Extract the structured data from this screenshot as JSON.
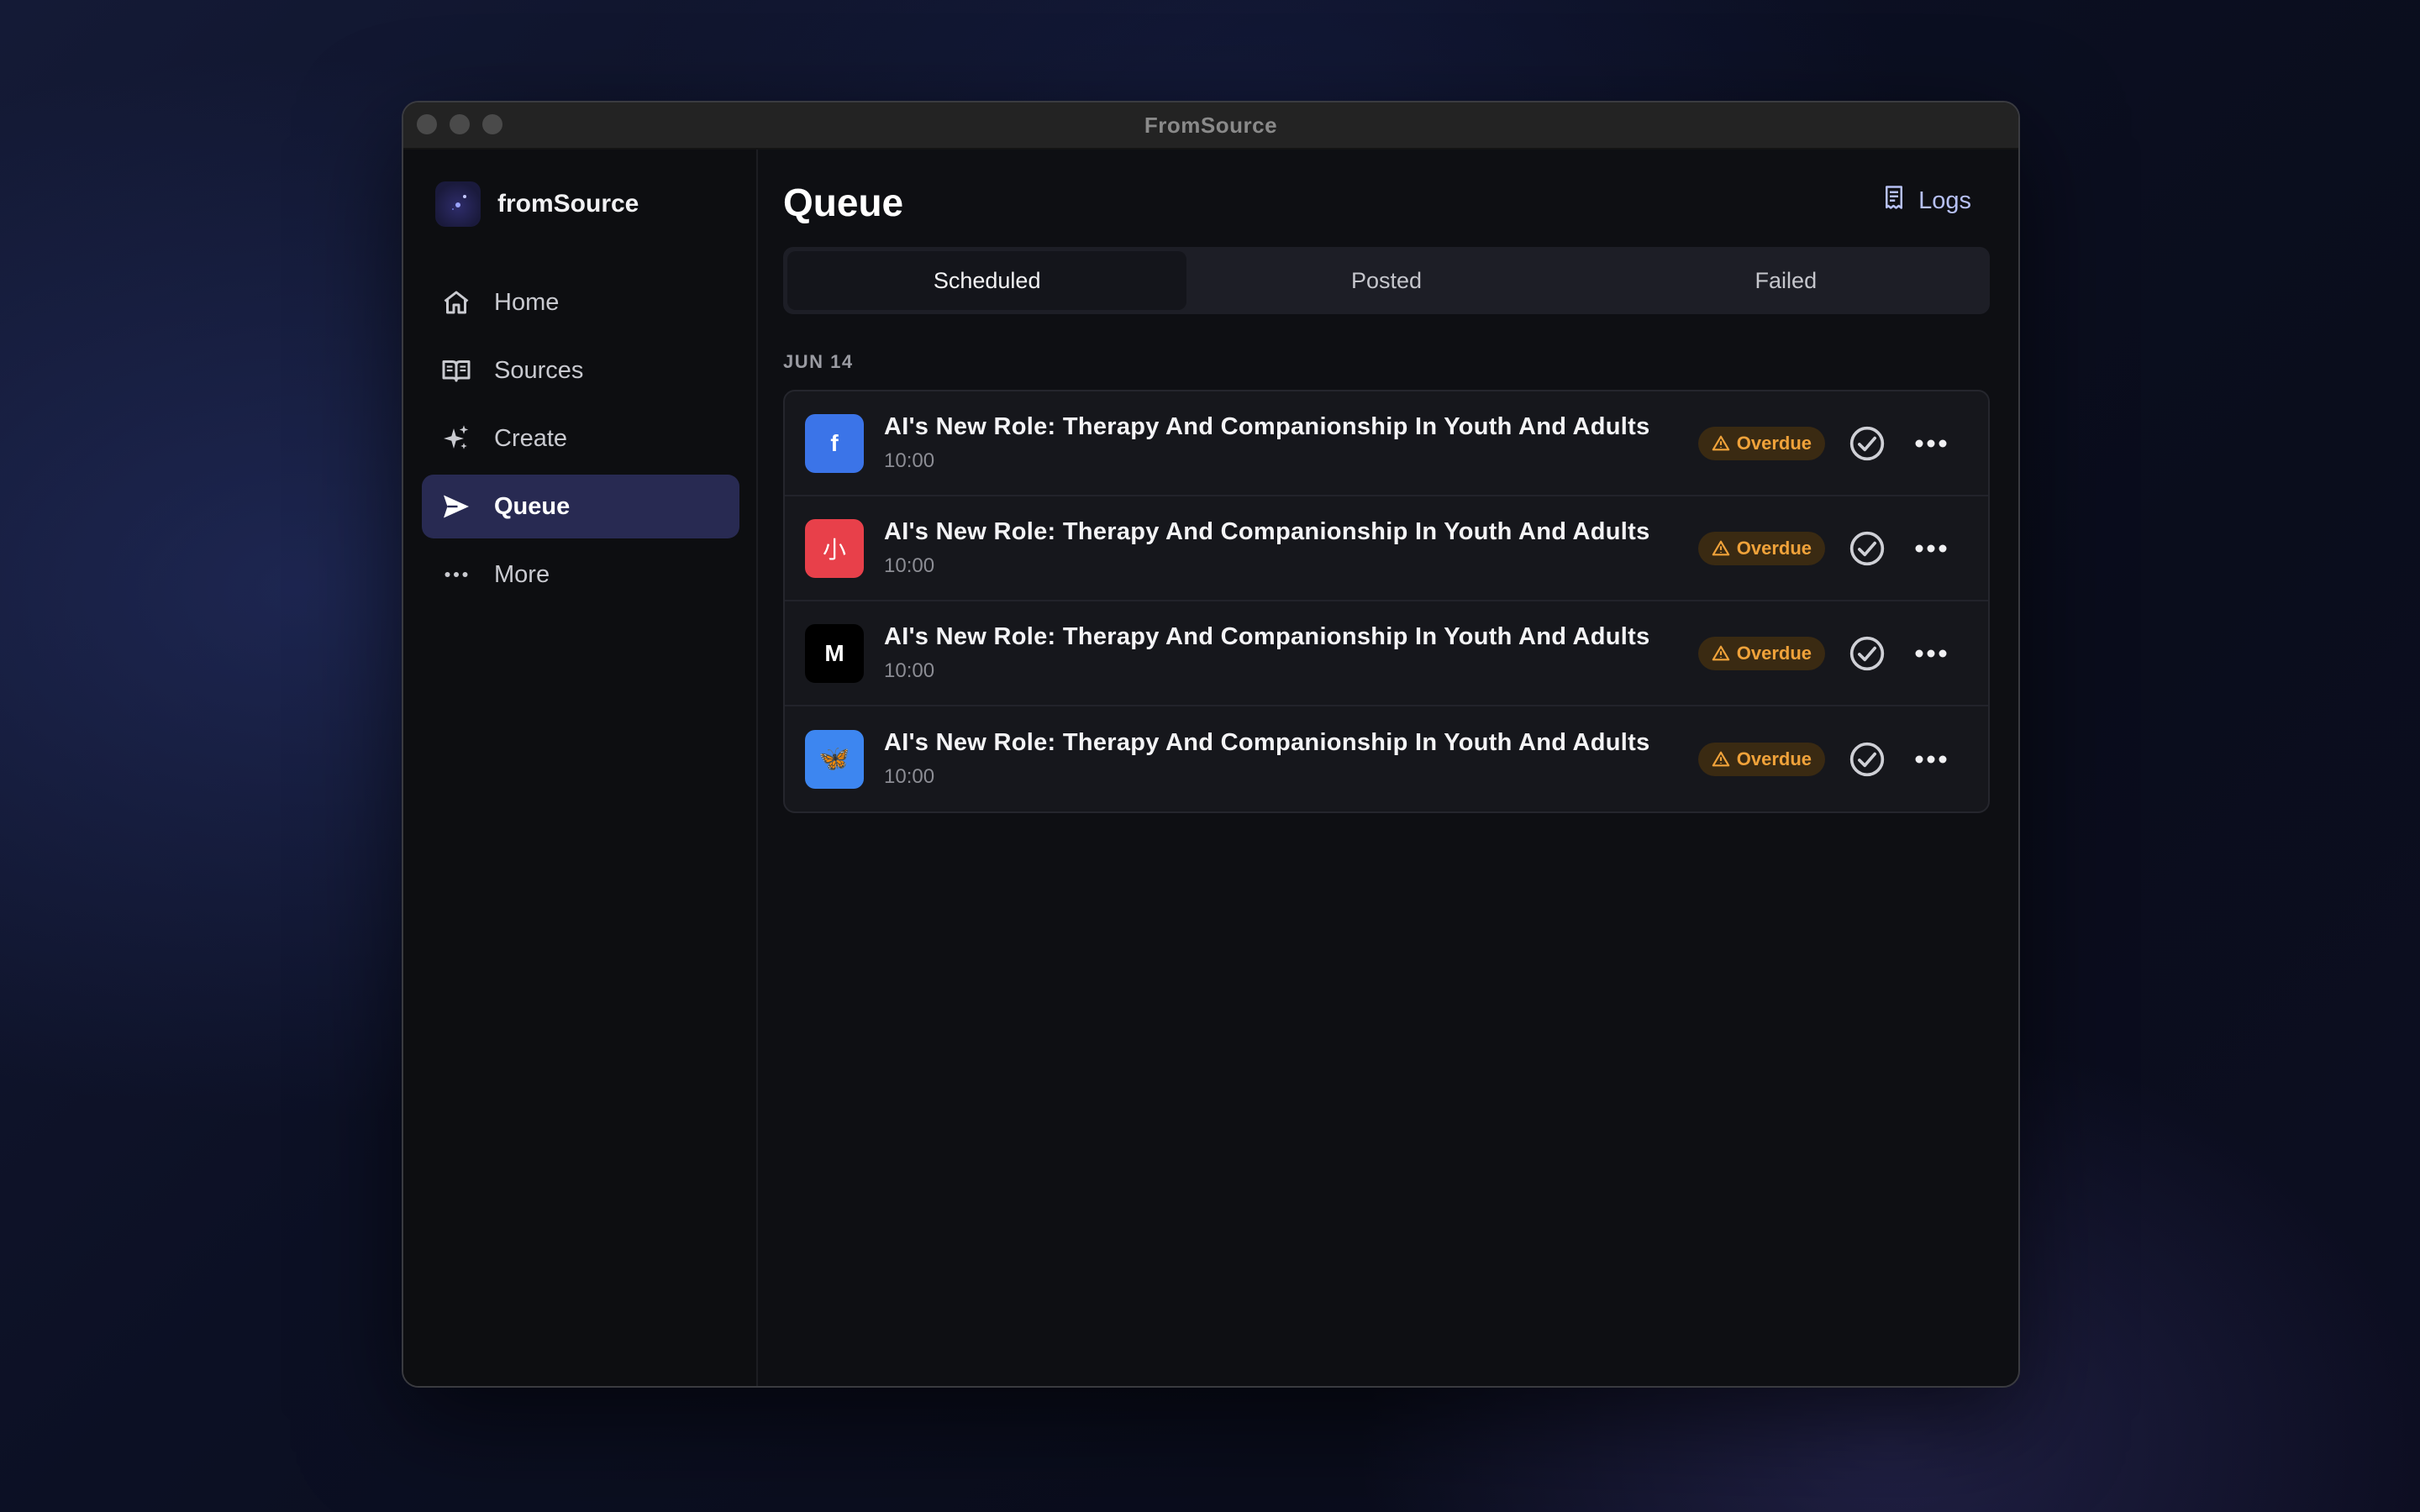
{
  "window": {
    "title": "FromSource"
  },
  "brand": {
    "name": "fromSource"
  },
  "nav": {
    "items": [
      {
        "label": "Home",
        "icon": "home-icon"
      },
      {
        "label": "Sources",
        "icon": "book-icon"
      },
      {
        "label": "Create",
        "icon": "sparkles-icon"
      },
      {
        "label": "Queue",
        "icon": "send-icon",
        "active": true
      },
      {
        "label": "More",
        "icon": "ellipsis-icon"
      }
    ]
  },
  "page": {
    "title": "Queue",
    "logs_label": "Logs"
  },
  "tabs": [
    {
      "label": "Scheduled",
      "active": true
    },
    {
      "label": "Posted"
    },
    {
      "label": "Failed"
    }
  ],
  "queue": {
    "date_label": "JUN 14",
    "items": [
      {
        "platform": "facebook",
        "platform_glyph": "f",
        "color": "#3b74e8",
        "title": "AI's New Role: Therapy And Companionship In Youth And Adults",
        "time": "10:00",
        "status": "Overdue"
      },
      {
        "platform": "xiaohongshu",
        "platform_glyph": "小",
        "color": "#e8404a",
        "title": "AI's New Role: Therapy And Companionship In Youth And Adults",
        "time": "10:00",
        "status": "Overdue"
      },
      {
        "platform": "medium",
        "platform_glyph": "M",
        "color": "#000000",
        "title": "AI's New Role: Therapy And Companionship In Youth And Adults",
        "time": "10:00",
        "status": "Overdue"
      },
      {
        "platform": "bluesky",
        "platform_glyph": "🦋",
        "color": "#3d86f0",
        "title": "AI's New Role: Therapy And Companionship In Youth And Adults",
        "time": "10:00",
        "status": "Overdue"
      }
    ]
  },
  "colors": {
    "accent_nav_active": "#282a52",
    "overdue": "#f0a23a",
    "logs_link": "#b6c0f4"
  }
}
